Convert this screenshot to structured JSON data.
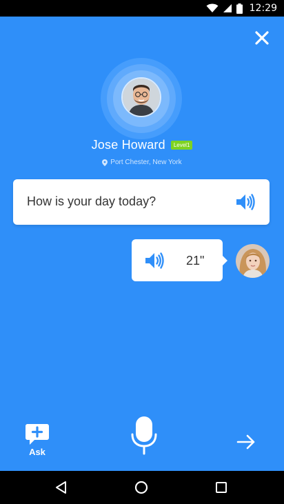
{
  "status_bar": {
    "time": "12:29",
    "icons": [
      "wifi-icon",
      "signal-icon",
      "battery-icon"
    ]
  },
  "profile": {
    "name": "Jose Howard",
    "level": "Level1",
    "location": "Port Chester, New York"
  },
  "question": {
    "text": "How is your day today?"
  },
  "reply": {
    "duration": "21\""
  },
  "actions": {
    "ask_label": "Ask"
  },
  "colors": {
    "background": "#2f8ff9",
    "accent": "#2f8ff9",
    "level_badge": "#7ed321",
    "card": "#ffffff"
  }
}
